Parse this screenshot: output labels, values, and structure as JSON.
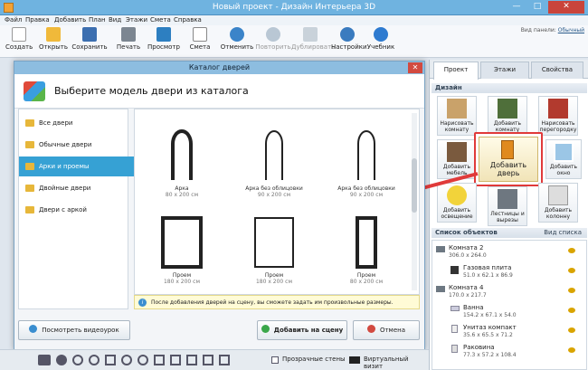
{
  "window": {
    "title": "Новый проект - Дизайн Интерьера 3D"
  },
  "menu": [
    "Файл",
    "Правка",
    "Добавить",
    "План",
    "Вид",
    "Этажи",
    "Смета",
    "Справка"
  ],
  "toolbar": [
    "Создать",
    "Открыть",
    "Сохранить",
    "Печать",
    "Просмотр",
    "Смета",
    "Отменить",
    "Повторить",
    "Дублировать",
    "Настройки",
    "Учебник"
  ],
  "help": {
    "label": "Вид панели:",
    "value": "Обычный"
  },
  "dialog": {
    "title": "Каталог дверей",
    "heading": "Выберите модель двери из каталога",
    "categories": [
      "Все двери",
      "Обычные двери",
      "Арки и проемы",
      "Двойные двери",
      "Двери с аркой"
    ],
    "doors": [
      {
        "name": "Арка",
        "size": "80 x 200 см"
      },
      {
        "name": "Арка без облицовки",
        "size": "90 x 200 см"
      },
      {
        "name": "Арка без облицовки",
        "size": "90 x 200 см"
      },
      {
        "name": "Проем",
        "size": "180 x 200 см"
      },
      {
        "name": "Проем",
        "size": "180 x 200 см"
      },
      {
        "name": "Проем",
        "size": "80 x 200 см"
      }
    ],
    "info": "После добавления дверей на сцену, вы сможете задать им произвольные размеры.",
    "video_btn": "Посмотреть видеоурок",
    "add_btn": "Добавить на сцену",
    "cancel_btn": "Отмена"
  },
  "panel": {
    "tabs": [
      "Проект",
      "Этажи",
      "Свойства"
    ],
    "design": "Дизайн",
    "buttons": [
      "Нарисовать комнату",
      "Добавить комнату",
      "Нарисовать перегородку",
      "Добавить мебель",
      "Добавить дверь",
      "Добавить окно",
      "Добавить освещение",
      "Лестницы и вырезы",
      "Добавить колонну"
    ],
    "objects_title": "Список объектов",
    "view_list": "Вид списка",
    "objects": [
      {
        "name": "Комната 2",
        "size": "306.0 x 264.0"
      },
      {
        "name": "Газовая плита",
        "size": "51.0 x 62.1 x 86.9"
      },
      {
        "name": "Комната 4",
        "size": "170.0 x 217.7"
      },
      {
        "name": "Ванна",
        "size": "154.2 x 67.1 x 54.0"
      },
      {
        "name": "Унитаз компакт",
        "size": "35.6 x 65.5 x 71.2"
      },
      {
        "name": "Раковина",
        "size": "77.3 x 57.2 x 108.4"
      }
    ]
  },
  "bottom": {
    "transparent": "Прозрачные стены",
    "virtual": "Виртуальный визит"
  },
  "colors": {
    "accent": "#36a1d4",
    "highlight": "#e03a3a"
  }
}
